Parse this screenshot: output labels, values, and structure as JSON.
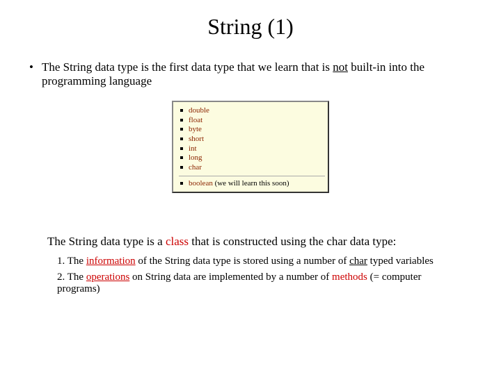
{
  "title": "String (1)",
  "bullet": {
    "pre": "The String data type is the first data type that we learn that is ",
    "not": "not",
    "post": " built-in into the programming language"
  },
  "types": {
    "items": [
      "double",
      "float",
      "byte",
      "short",
      "int",
      "long",
      "char"
    ],
    "boolean": "boolean",
    "boolean_note": " (we will learn this soon)"
  },
  "followup": {
    "pre": "The String data type is a ",
    "class": "class",
    "post": " that is constructed using the char data type:"
  },
  "num1": {
    "a": "1. The ",
    "info": "information",
    "b": " of the String data type is stored using a number of ",
    "char": "char",
    "c": " typed variables"
  },
  "num2": {
    "a": "2. The ",
    "ops": "operations",
    "b": " on String data are implemented by a number of ",
    "methods": "methods",
    "c": " (= computer programs)"
  }
}
